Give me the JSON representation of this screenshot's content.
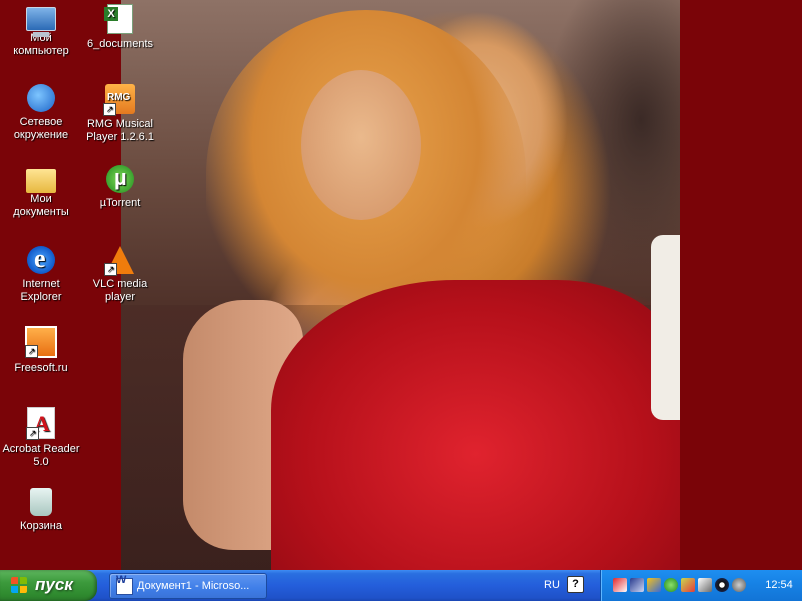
{
  "desktop": {
    "background_color": "#7a0408",
    "icons": [
      {
        "label": "Мой компьютер",
        "icon": "my-computer-icon"
      },
      {
        "label": "6_documents",
        "icon": "excel-document-icon"
      },
      {
        "label": "Сетевое окружение",
        "icon": "network-neighborhood-icon"
      },
      {
        "label": "RMG Musical Player 1.2.6.1",
        "icon": "rmg-player-icon"
      },
      {
        "label": "Мои документы",
        "icon": "my-documents-icon"
      },
      {
        "label": "µTorrent",
        "icon": "utorrent-icon"
      },
      {
        "label": "Internet Explorer",
        "icon": "internet-explorer-icon"
      },
      {
        "label": "VLC media player",
        "icon": "vlc-icon"
      },
      {
        "label": "Freesoft.ru",
        "icon": "freesoft-icon"
      },
      {
        "label": "Acrobat Reader 5.0",
        "icon": "acrobat-reader-icon"
      },
      {
        "label": "Корзина",
        "icon": "recycle-bin-icon"
      }
    ]
  },
  "taskbar": {
    "start_label": "пуск",
    "tasks": [
      {
        "label": "Документ1 - Microso...",
        "icon": "word-document-icon"
      }
    ],
    "language": "RU",
    "help": "?",
    "clock": "12:54",
    "tray_icons": [
      "tray-app-icon-1",
      "tray-app-icon-2",
      "tray-app-icon-3",
      "tray-app-icon-4",
      "tray-app-icon-5",
      "tray-app-icon-6",
      "tray-app-icon-7",
      "tray-app-icon-8"
    ]
  },
  "colors": {
    "taskbar_blue": "#245edb",
    "start_green": "#3c9a3c",
    "tray_blue": "#1783e6"
  }
}
